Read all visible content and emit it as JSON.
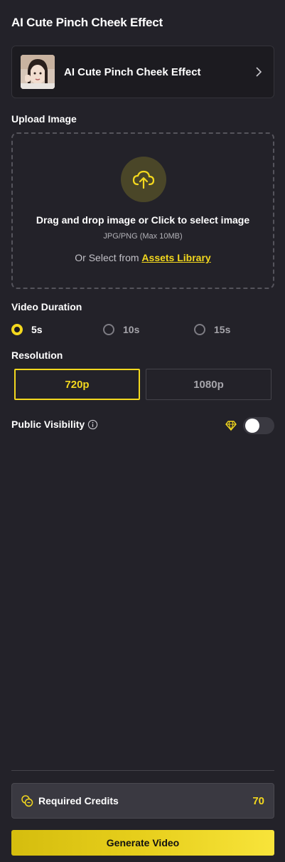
{
  "page_title": "AI Cute Pinch Cheek Effect",
  "effect_card": {
    "name": "AI Cute Pinch Cheek Effect",
    "thumbnail_icon": "portrait-thumbnail",
    "chevron_icon": "chevron-right-icon"
  },
  "upload": {
    "label": "Upload Image",
    "icon": "cloud-upload-icon",
    "main_text": "Drag and drop image or Click to select image",
    "sub_text": "JPG/PNG (Max 10MB)",
    "or_text": "Or Select from ",
    "assets_link": "Assets Library"
  },
  "duration": {
    "label": "Video Duration",
    "options": [
      "5s",
      "10s",
      "15s"
    ],
    "selected": "5s"
  },
  "resolution": {
    "label": "Resolution",
    "options": [
      "720p",
      "1080p"
    ],
    "selected": "720p"
  },
  "visibility": {
    "label": "Public Visibility",
    "info_icon": "info-icon",
    "premium_icon": "diamond-icon",
    "enabled": false
  },
  "credits": {
    "icon": "coins-icon",
    "label": "Required Credits",
    "value": "70"
  },
  "generate_button": "Generate Video",
  "colors": {
    "background": "#232229",
    "accent": "#f3d81e",
    "card": "#1c1b20",
    "credits_box": "#3a3941"
  }
}
